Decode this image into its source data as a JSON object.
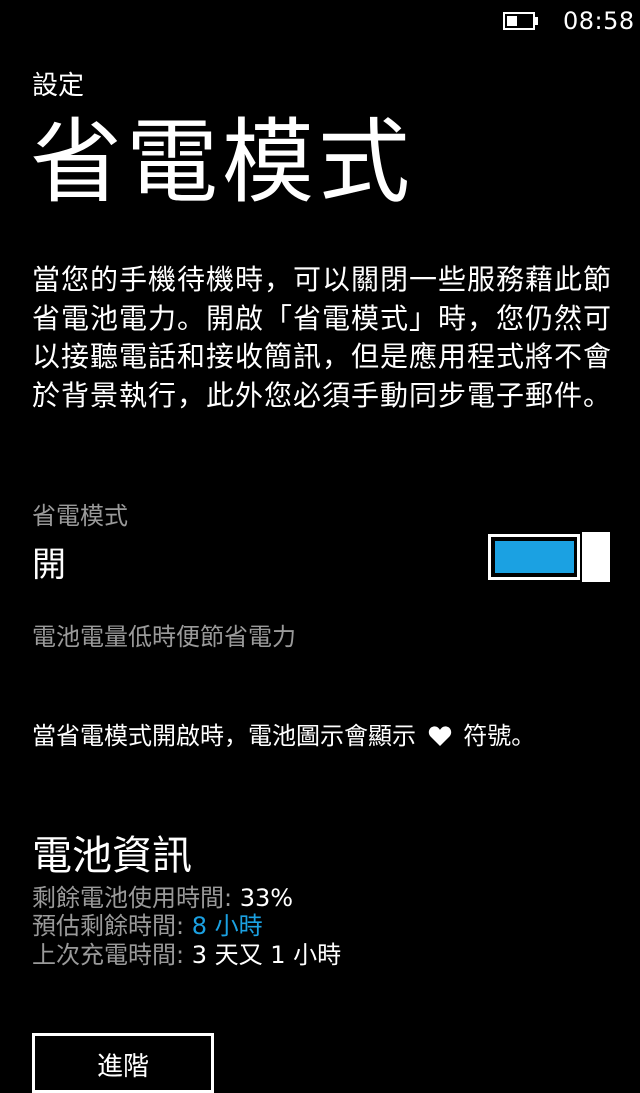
{
  "status_bar": {
    "time": "08:58",
    "battery_icon": "battery-icon"
  },
  "header": {
    "section": "設定",
    "title": "省電模式"
  },
  "description": "當您的手機待機時，可以關閉一些服務藉此節省電池電力。開啟「省電模式」時，您仍然可以接聽電話和接收簡訊，但是應用程式將不會於背景執行，此外您必須手動同步電子郵件。",
  "battery_saver_toggle": {
    "label": "省電模式",
    "state": "開",
    "is_on": true,
    "accent_color": "#1ba1e2"
  },
  "low_battery_option": "電池電量低時便節省電力",
  "indicator_note": {
    "before": "當省電模式開啟時，電池圖示會顯示",
    "icon": "heart-icon",
    "after": "符號。"
  },
  "battery_info": {
    "heading": "電池資訊",
    "remaining_usage_label": "剩餘電池使用時間:",
    "remaining_usage_value": "33%",
    "estimated_time_label": "預估剩餘時間:",
    "estimated_time_value": "8 小時",
    "last_charged_label": "上次充電時間:",
    "last_charged_value": "3 天又 1 小時"
  },
  "advanced_button": "進階",
  "colors": {
    "background": "#000000",
    "text": "#ffffff",
    "subtle_text": "#9a9a9a",
    "accent": "#1ba1e2"
  }
}
